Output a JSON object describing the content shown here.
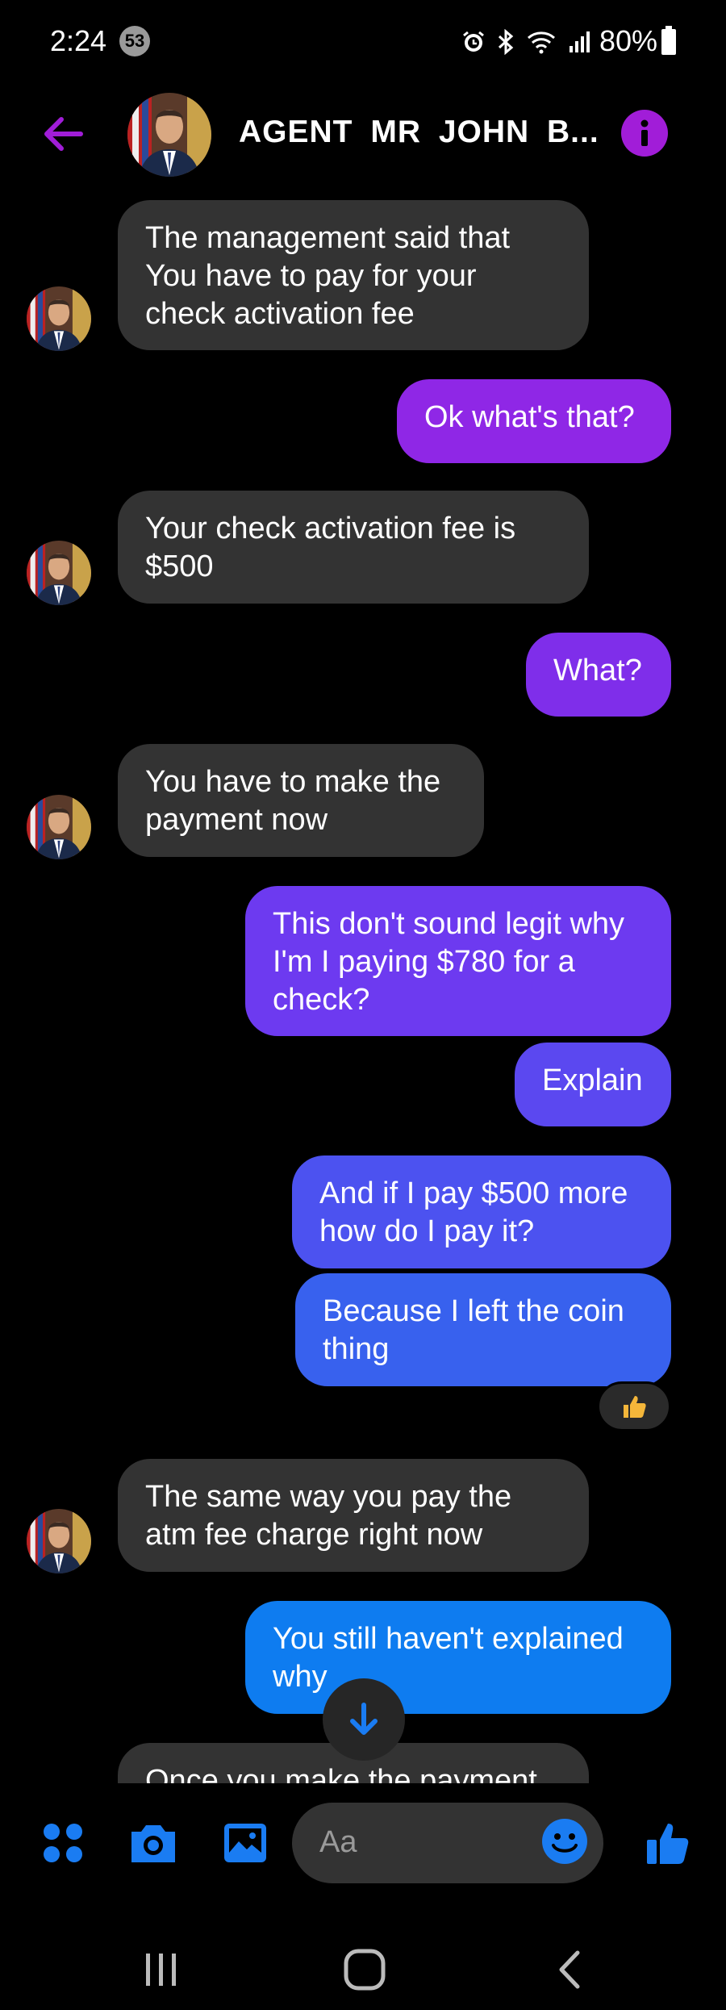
{
  "status_bar": {
    "time": "2:24",
    "notification_count": "53",
    "battery": "80%",
    "icons": [
      "alarm-icon",
      "bluetooth-icon",
      "wifi-icon",
      "signal-icon",
      "battery-icon"
    ]
  },
  "header": {
    "title": "AGENT MR JOHN B...",
    "accent_color": "#a11dd8",
    "icons": [
      "back-arrow-icon",
      "info-icon"
    ]
  },
  "messages": [
    {
      "dir": "in",
      "text": "The management said that You have to pay for your check activation fee"
    },
    {
      "dir": "out",
      "text": "Ok what's that?"
    },
    {
      "dir": "in",
      "text": "Your check activation fee is $500"
    },
    {
      "dir": "out",
      "text": "What?"
    },
    {
      "dir": "in",
      "text": "You have to make the payment now"
    },
    {
      "dir": "out",
      "text": "This don't sound legit why I'm I paying $780 for a check?"
    },
    {
      "dir": "out",
      "text": "Explain"
    },
    {
      "dir": "out",
      "text": "And if I pay $500 more how do I pay it?"
    },
    {
      "dir": "out",
      "text": "Because I left the coin thing",
      "reaction": "thumbs-up"
    },
    {
      "dir": "in",
      "text": "The same way you pay the atm fee charge right now"
    },
    {
      "dir": "out",
      "text": "You still haven't explained why"
    },
    {
      "dir": "in",
      "text": "Once you make the payment"
    }
  ],
  "composer": {
    "placeholder": "Aa",
    "icons": [
      "menu-dots-icon",
      "camera-icon",
      "gallery-icon",
      "emoji-icon",
      "like-thumb-icon"
    ],
    "accent_color": "#1a7cf2"
  },
  "nav_bar": {
    "icons": [
      "recent-apps-icon",
      "home-icon",
      "back-icon"
    ]
  },
  "colors": {
    "incoming_bubble": "#333333",
    "outgoing_gradient_top": "#8f27e6",
    "outgoing_gradient_bottom": "#0c7cf0"
  }
}
